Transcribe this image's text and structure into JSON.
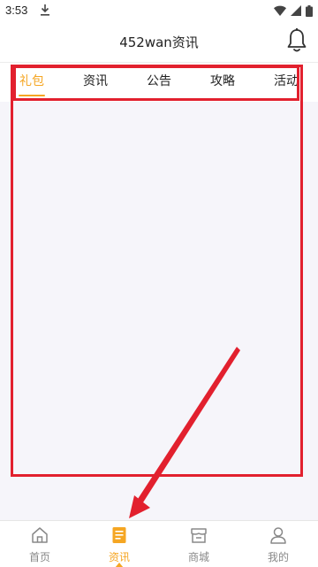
{
  "status_bar": {
    "time": "3:53",
    "download_icon": "download-icon",
    "icons": [
      "wifi-icon",
      "signal-icon",
      "battery-icon"
    ]
  },
  "header": {
    "title": "452wan资讯",
    "bell_icon": "bell-icon"
  },
  "tabs": [
    {
      "label": "礼包",
      "active": true
    },
    {
      "label": "资讯",
      "active": false
    },
    {
      "label": "公告",
      "active": false
    },
    {
      "label": "攻略",
      "active": false
    },
    {
      "label": "活动",
      "active": false
    }
  ],
  "bottom_nav": [
    {
      "label": "首页",
      "icon": "home-icon",
      "active": false
    },
    {
      "label": "资讯",
      "icon": "news-icon",
      "active": true
    },
    {
      "label": "商城",
      "icon": "store-icon",
      "active": false
    },
    {
      "label": "我的",
      "icon": "profile-icon",
      "active": false
    }
  ],
  "colors": {
    "accent": "#f5a623",
    "annotation": "#e2202e",
    "content_bg": "#f6f5fa"
  }
}
